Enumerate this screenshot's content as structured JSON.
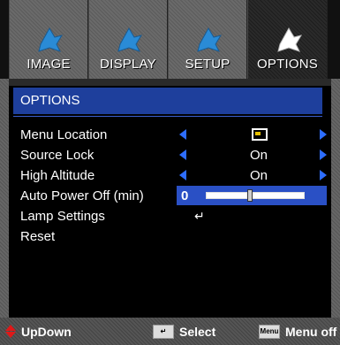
{
  "tabs": [
    {
      "label": "IMAGE",
      "icon": "star-icon",
      "active": false
    },
    {
      "label": "DISPLAY",
      "icon": "star-icon",
      "active": false
    },
    {
      "label": "SETUP",
      "icon": "star-icon",
      "active": false
    },
    {
      "label": "OPTIONS",
      "icon": "star-icon",
      "active": true
    }
  ],
  "section": {
    "title": "OPTIONS"
  },
  "menu": {
    "menu_location": {
      "label": "Menu Location",
      "value_icon": "monitor-icon"
    },
    "source_lock": {
      "label": "Source Lock",
      "value": "On"
    },
    "high_altitude": {
      "label": "High Altitude",
      "value": "On"
    },
    "auto_power_off": {
      "label": "Auto Power Off (min)",
      "value": "0",
      "slider_fraction": 0.45
    },
    "lamp_settings": {
      "label": "Lamp Settings",
      "value_icon": "enter-icon"
    },
    "reset": {
      "label": "Reset"
    }
  },
  "footer": {
    "updown": "UpDown",
    "select": "Select",
    "menu_off": "Menu off",
    "menu_key": "Menu"
  },
  "colors": {
    "accent": "#2a50c5",
    "section_bar": "#1e3f9c",
    "arrow": "#2d6dff",
    "updown_icon": "#e01818"
  }
}
